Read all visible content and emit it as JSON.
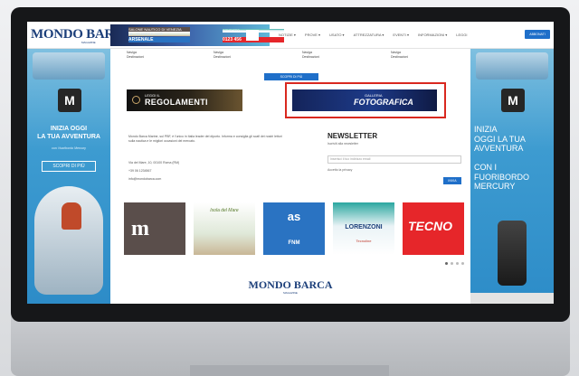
{
  "site": {
    "logo": "MONDO BARCA",
    "logo_sub": "MAGAZINE"
  },
  "top_ad": {
    "line1": "SALONE NAUTICO DI VENEZIA",
    "line2": "18 - 23 APRILE 2023",
    "line3": "ARSENALE",
    "line4": "CONTATTO",
    "line5": "0123 456"
  },
  "nav": {
    "items": [
      "NOTIZIE ▾",
      "PROVE ▾",
      "USATO ▾",
      "ATTREZZATURA ▾",
      "EVENTI ▾",
      "INFORMAZIONI ▾",
      "LEGGI"
    ],
    "subscribe": "ABBONATI"
  },
  "left_banner": {
    "logo_letter": "M",
    "headline": "INIZIA OGGI\nLA TUA AVVENTURA",
    "small": "con i fuoribordo Mercury",
    "button": "SCOPRI DI PIÙ"
  },
  "right_banner": {
    "logo_letter": "M",
    "headline": "INIZIA\nOGGI LA TUA\nAVVENTURA\n\nCON I\nFUORIBORDO\nMERCURY"
  },
  "main": {
    "link_cols": [
      {
        "title": "Naviga",
        "sub": "Destinazioni"
      },
      {
        "title": "Naviga",
        "sub": "Destinazioni"
      },
      {
        "title": "Naviga",
        "sub": "Destinazioni"
      },
      {
        "title": "Naviga",
        "sub": "Destinazioni"
      }
    ],
    "tab_label": "SCOPRI DI PIÙ",
    "banner1_small": "LEGGI IL",
    "banner1_big": "REGOLAMENTI",
    "banner2_small": "GALLERIA",
    "banner2_big": "FOTOGRAFICA",
    "about": "Mondo Barca Marine, sul PBF, è l'unico in Italia leader del diporto. Informa e consiglia gli scafi dei nostri lettori sulla nautica e le migliori occasioni del mercato.",
    "contacts": [
      "Via del Mare, 10, 00100 Roma (RM)",
      "+39 06 1234567",
      "info@mondobarca.com"
    ],
    "newsletter": {
      "title": "NEWSLETTER",
      "sub": "Iscriviti alla newsletter",
      "input_placeholder": "Inserisci il tuo indirizzo email",
      "privacy": "Accetto la privacy",
      "button": "INVIA"
    },
    "tiles": {
      "t1": "m",
      "t2": "Isola del Mare",
      "t3a": "as",
      "t3b": "FNM",
      "t4a": "LORENZONI",
      "t4b": "Tecnoline",
      "t5": "TECNO"
    },
    "footer_logo": "MONDO BARCA",
    "footer_sub": "MAGAZINE"
  }
}
